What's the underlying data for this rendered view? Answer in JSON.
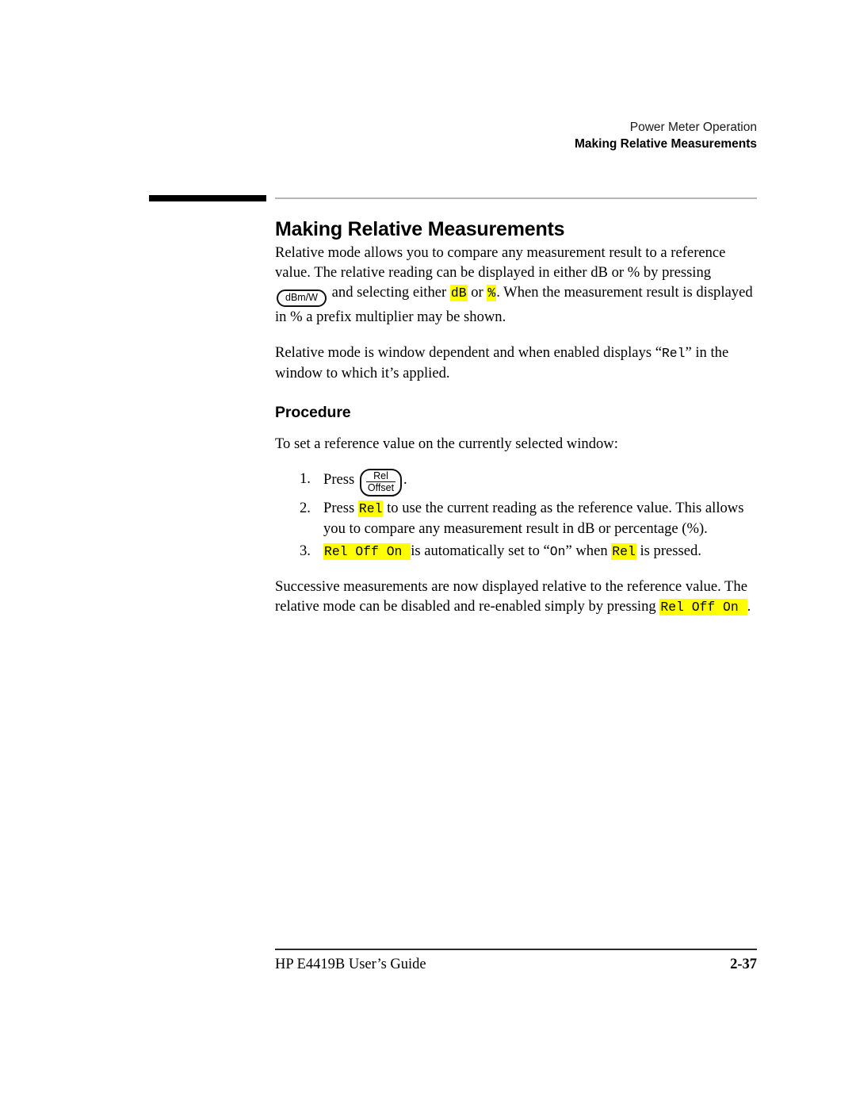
{
  "header": {
    "line1": "Power Meter Operation",
    "line2": "Making Relative Measurements"
  },
  "title": "Making Relative Measurements",
  "paragraphs": {
    "intro_part1": "Relative mode allows you to compare any measurement result to a reference value. The relative reading can be displayed in either dB or % by pressing",
    "intro_key": "dBm/W",
    "intro_part2": "and selecting either",
    "intro_token_db": "dB",
    "intro_or": "or",
    "intro_token_pct": "%",
    "intro_part3": ". When the measurement result is displayed in % a prefix multiplier may be shown.",
    "window_part1": "Relative mode is window dependent and when enabled displays “",
    "window_token_rel": "Rel",
    "window_part2": "” in the window to which it’s applied."
  },
  "procedure": {
    "heading": "Procedure",
    "lead_in": "To set a reference value on the currently selected window:",
    "steps": [
      {
        "number": "1.",
        "text_before": "Press",
        "key_top": "Rel",
        "key_bottom": "Offset",
        "text_after": "."
      },
      {
        "number": "2.",
        "text_before": "Press",
        "token": "Rel",
        "text_after": "to use the current reading as the reference value. This allows you to compare any measurement result in dB or percentage (%)."
      },
      {
        "number": "3.",
        "token_key": "Rel Off On ",
        "text_middle": "is automatically set to “",
        "token_on": "On",
        "text_middle2": "” when",
        "token_rel": "Rel",
        "text_after": "is pressed."
      }
    ]
  },
  "closing": {
    "part1": "Successive measurements are now displayed relative to the reference value. The relative mode can be disabled and re-enabled simply by pressing",
    "token": "Rel Off On ",
    "part2": "."
  },
  "footer": {
    "left": "HP E4419B User’s Guide",
    "right": "2-37"
  },
  "colors": {
    "highlight": "#ffff00",
    "rule_thin": "#b5b5b5",
    "rule_thick": "#000000"
  }
}
